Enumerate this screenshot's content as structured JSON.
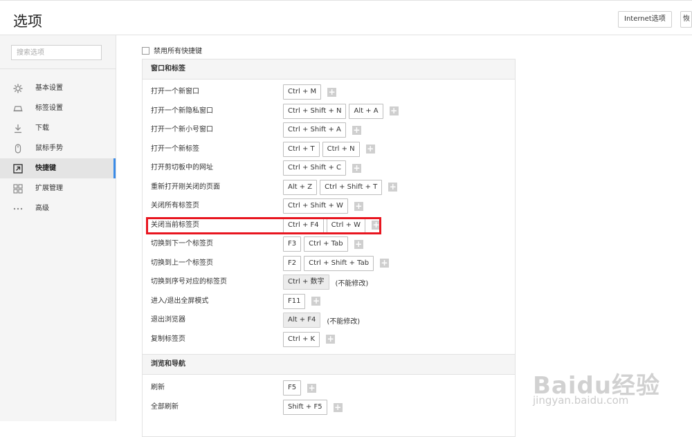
{
  "header": {
    "title": "选项",
    "internet_options_label": "Internet选项",
    "restore_label": "恢"
  },
  "sidebar": {
    "search_placeholder": "搜索选项",
    "items": [
      {
        "label": "基本设置",
        "icon": "gear-icon",
        "active": false
      },
      {
        "label": "标签设置",
        "icon": "tab-icon",
        "active": false
      },
      {
        "label": "下载",
        "icon": "download-icon",
        "active": false
      },
      {
        "label": "鼠标手势",
        "icon": "mouse-icon",
        "active": false
      },
      {
        "label": "快捷键",
        "icon": "shortcut-icon",
        "active": true
      },
      {
        "label": "扩展管理",
        "icon": "extensions-icon",
        "active": false
      },
      {
        "label": "高级",
        "icon": "more-icon",
        "active": false
      }
    ]
  },
  "main": {
    "disable_all_label": "禁用所有快捷键",
    "sections": [
      {
        "title": "窗口和标签",
        "rows": [
          {
            "label": "打开一个新窗口",
            "keys": [
              "Ctrl + M"
            ],
            "editable": true
          },
          {
            "label": "打开一个新隐私窗口",
            "keys": [
              "Ctrl + Shift + N",
              "Alt + A"
            ],
            "editable": true
          },
          {
            "label": "打开一个新小号窗口",
            "keys": [
              "Ctrl + Shift + A"
            ],
            "editable": true
          },
          {
            "label": "打开一个新标签",
            "keys": [
              "Ctrl + T",
              "Ctrl + N"
            ],
            "editable": true
          },
          {
            "label": "打开剪切板中的网址",
            "keys": [
              "Ctrl + Shift + C"
            ],
            "editable": true
          },
          {
            "label": "重新打开刚关闭的页面",
            "keys": [
              "Alt + Z",
              "Ctrl + Shift + T"
            ],
            "editable": true
          },
          {
            "label": "关闭所有标签页",
            "keys": [
              "Ctrl + Shift + W"
            ],
            "editable": true
          },
          {
            "label": "关闭当前标签页",
            "keys": [
              "Ctrl + F4",
              "Ctrl + W"
            ],
            "editable": true
          },
          {
            "label": "切换到下一个标签页",
            "keys": [
              "F3",
              "Ctrl + Tab"
            ],
            "editable": true
          },
          {
            "label": "切换到上一个标签页",
            "keys": [
              "F2",
              "Ctrl + Shift + Tab"
            ],
            "editable": true
          },
          {
            "label": "切换到序号对应的标签页",
            "keys": [
              "Ctrl + 数字"
            ],
            "editable": false,
            "note": "(不能修改)"
          },
          {
            "label": "进入/退出全屏模式",
            "keys": [
              "F11"
            ],
            "editable": true
          },
          {
            "label": "退出浏览器",
            "keys": [
              "Alt + F4"
            ],
            "editable": false,
            "note": "(不能修改)"
          },
          {
            "label": "复制标签页",
            "keys": [
              "Ctrl + K"
            ],
            "editable": true
          }
        ]
      },
      {
        "title": "浏览和导航",
        "rows": [
          {
            "label": "刷新",
            "keys": [
              "F5"
            ],
            "editable": true
          },
          {
            "label": "全部刷新",
            "keys": [
              "Shift + F5"
            ],
            "editable": true
          }
        ]
      }
    ],
    "plus_symbol": "+"
  },
  "watermark": {
    "logo": "Baidu经验",
    "url": "jingyan.baidu.com"
  },
  "colors": {
    "highlight": "#e8151f",
    "active_accent": "#3a8be8"
  }
}
